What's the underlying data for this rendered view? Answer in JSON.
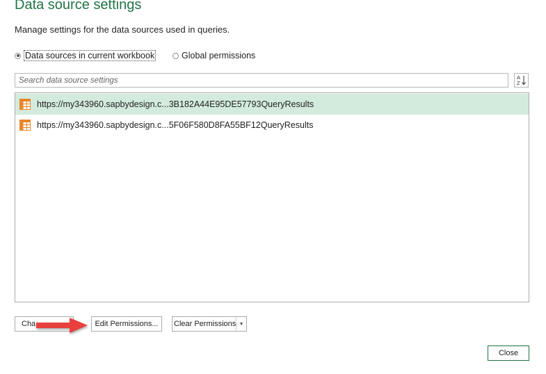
{
  "dialog": {
    "title": "Data source settings",
    "subtitle": "Manage settings for the data sources used in queries."
  },
  "scope": {
    "option_current": "Data sources in current workbook",
    "option_global": "Global permissions",
    "selected": "current"
  },
  "search": {
    "placeholder": "Search data source settings",
    "value": ""
  },
  "sort": {
    "icon": "sort-az-icon"
  },
  "sources": [
    {
      "label": "https://my343960.sapbydesign.c...3B182A44E95DE57793QueryResults",
      "icon": "table-icon",
      "selected": true
    },
    {
      "label": "https://my343960.sapbydesign.c...5F06F580D8FA55BF12QueryResults",
      "icon": "table-icon",
      "selected": false
    }
  ],
  "buttons": {
    "change_source": "Cha",
    "edit_permissions": "Edit Permissions...",
    "clear_permissions": "Clear Permissions",
    "close": "Close"
  },
  "colors": {
    "accent": "#217346",
    "selection": "#d3ebdd",
    "annotation_arrow": "#e8413c",
    "table_icon": "#e8862a"
  }
}
